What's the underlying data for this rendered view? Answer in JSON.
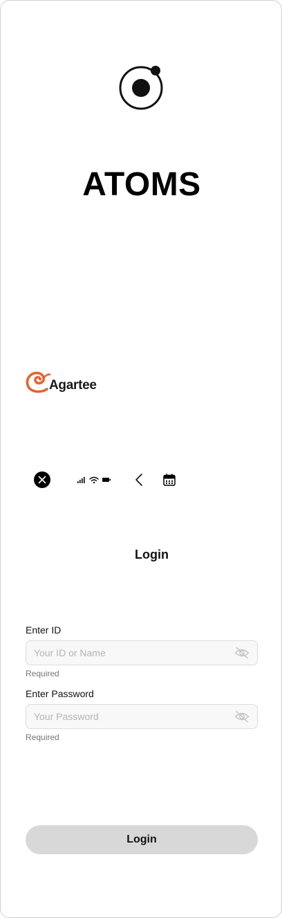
{
  "app": {
    "title": "ATOMS",
    "logo_icon": "atom-logo-icon"
  },
  "brand": {
    "name": "Agartee",
    "accent_color": "#e8612c"
  },
  "toolbar_icons": [
    "close-circle-icon",
    "signal-icon",
    "wifi-icon",
    "battery-icon",
    "back-chevron-icon",
    "calendar-icon"
  ],
  "form": {
    "heading": "Login",
    "id_field": {
      "label": "Enter ID",
      "placeholder": "Your ID or Name",
      "value": "",
      "helper": "Required"
    },
    "password_field": {
      "label": "Enter Password",
      "placeholder": "Your Password",
      "value": "",
      "helper": "Required"
    },
    "submit_label": "Login"
  }
}
